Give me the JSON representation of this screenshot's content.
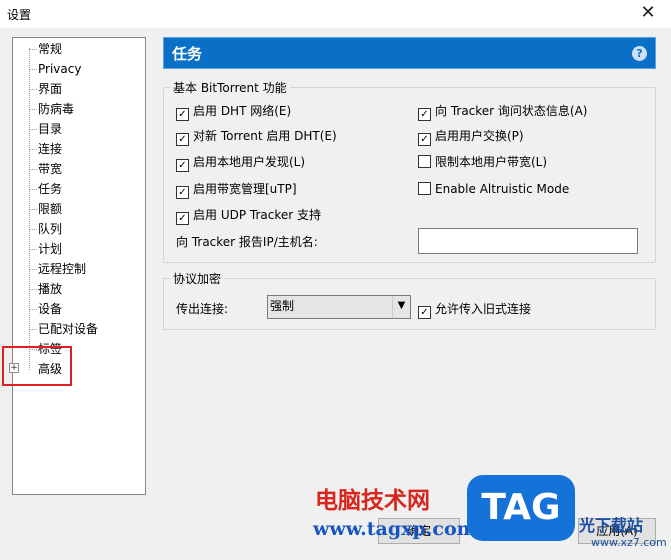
{
  "window": {
    "title": "设置",
    "close_glyph": "✕"
  },
  "sidebar": {
    "items": [
      {
        "label": "常规"
      },
      {
        "label": "Privacy"
      },
      {
        "label": "界面"
      },
      {
        "label": "防病毒"
      },
      {
        "label": "目录"
      },
      {
        "label": "连接"
      },
      {
        "label": "带宽"
      },
      {
        "label": "任务"
      },
      {
        "label": "限额"
      },
      {
        "label": "队列"
      },
      {
        "label": "计划"
      },
      {
        "label": "远程控制"
      },
      {
        "label": "播放"
      },
      {
        "label": "设备"
      },
      {
        "label": "已配对设备"
      },
      {
        "label": "标签"
      },
      {
        "label": "高级"
      }
    ],
    "expander_glyph": "+"
  },
  "panel": {
    "title": "任务",
    "help_glyph": "?"
  },
  "bittorrent": {
    "legend": "基本 BitTorrent 功能",
    "dht": {
      "label": "启用 DHT 网络(E)",
      "checked": true
    },
    "dht_new": {
      "label": "对新 Torrent 启用 DHT(E)",
      "checked": true
    },
    "local_peer": {
      "label": "启用本地用户发现(L)",
      "checked": true
    },
    "bw_mgmt": {
      "label": "启用带宽管理[uTP]",
      "checked": true
    },
    "udp_tracker": {
      "label": "启用 UDP Tracker 支持",
      "checked": true
    },
    "tracker_scrape": {
      "label": "向 Tracker 询问状态信息(A)",
      "checked": true
    },
    "peer_exchange": {
      "label": "启用用户交换(P)",
      "checked": true
    },
    "limit_local": {
      "label": "限制本地用户带宽(L)",
      "checked": false
    },
    "altruistic": {
      "label": "Enable Altruistic Mode",
      "checked": false
    },
    "report_ip_label": "向 Tracker 报告IP/主机名:",
    "report_ip_value": ""
  },
  "encryption": {
    "legend": "协议加密",
    "outgoing_label": "传出连接:",
    "outgoing_value": "强制",
    "allow_legacy": {
      "label": "允许传入旧式连接",
      "checked": true
    }
  },
  "buttons": {
    "apply": "应用(A)",
    "ok": "确定"
  },
  "watermark": {
    "site_cn": "电脑技术网",
    "site_url": "www.tagxp.com",
    "logo": "TAG",
    "right_text": "光下载站",
    "right_url": "www.xz7.com"
  },
  "colors": {
    "header_bg": "#0a6fc7",
    "highlight": "#e02020",
    "watermark_red": "#d8251d",
    "watermark_blue": "#1572d8"
  }
}
